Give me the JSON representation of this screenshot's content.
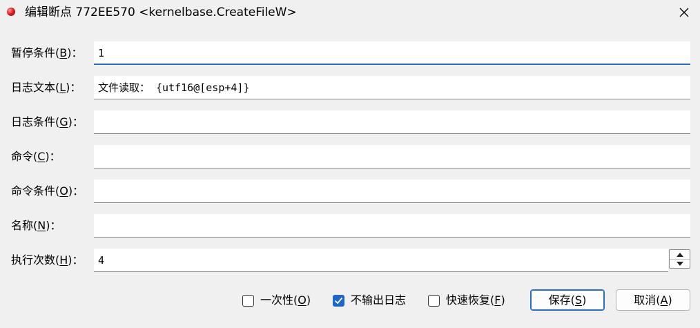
{
  "window": {
    "title": "编辑断点 772EE570 <kernelbase.CreateFileW>",
    "icon": "breakpoint-red-dot-icon",
    "close_icon": "close-icon"
  },
  "fields": {
    "pause_condition": {
      "label_pre": "暂停条件(",
      "mnemonic": "B",
      "label_post": ")：",
      "value": "1"
    },
    "log_text": {
      "label_pre": "日志文本(",
      "mnemonic": "L",
      "label_post": ")：",
      "value": "文件读取： {utf16@[esp+4]}"
    },
    "log_condition": {
      "label_pre": "日志条件(",
      "mnemonic": "G",
      "label_post": ")：",
      "value": ""
    },
    "command": {
      "label_pre": "命令(",
      "mnemonic": "C",
      "label_post": ")：",
      "value": ""
    },
    "command_condition": {
      "label_pre": "命令条件(",
      "mnemonic": "O",
      "label_post": ")：",
      "value": ""
    },
    "name": {
      "label_pre": "名称(",
      "mnemonic": "N",
      "label_post": ")：",
      "value": ""
    },
    "hit_count": {
      "label_pre": "执行次数(",
      "mnemonic": "H",
      "label_post": ")：",
      "value": "4"
    }
  },
  "options": {
    "one_time": {
      "label_pre": "一次性(",
      "mnemonic": "O",
      "label_post": ")",
      "checked": false
    },
    "silent": {
      "label": "不输出日志",
      "checked": true
    },
    "fast_resume": {
      "label_pre": "快速恢复(",
      "mnemonic": "F",
      "label_post": ")",
      "checked": false
    }
  },
  "buttons": {
    "save": {
      "label_pre": "保存(",
      "mnemonic": "S",
      "label_post": ")"
    },
    "cancel": {
      "label_pre": "取消(",
      "mnemonic": "A",
      "label_post": ")"
    }
  },
  "colors": {
    "accent": "#1f67c7",
    "background": "#f0f0f0",
    "icon_red": "#e02020"
  }
}
